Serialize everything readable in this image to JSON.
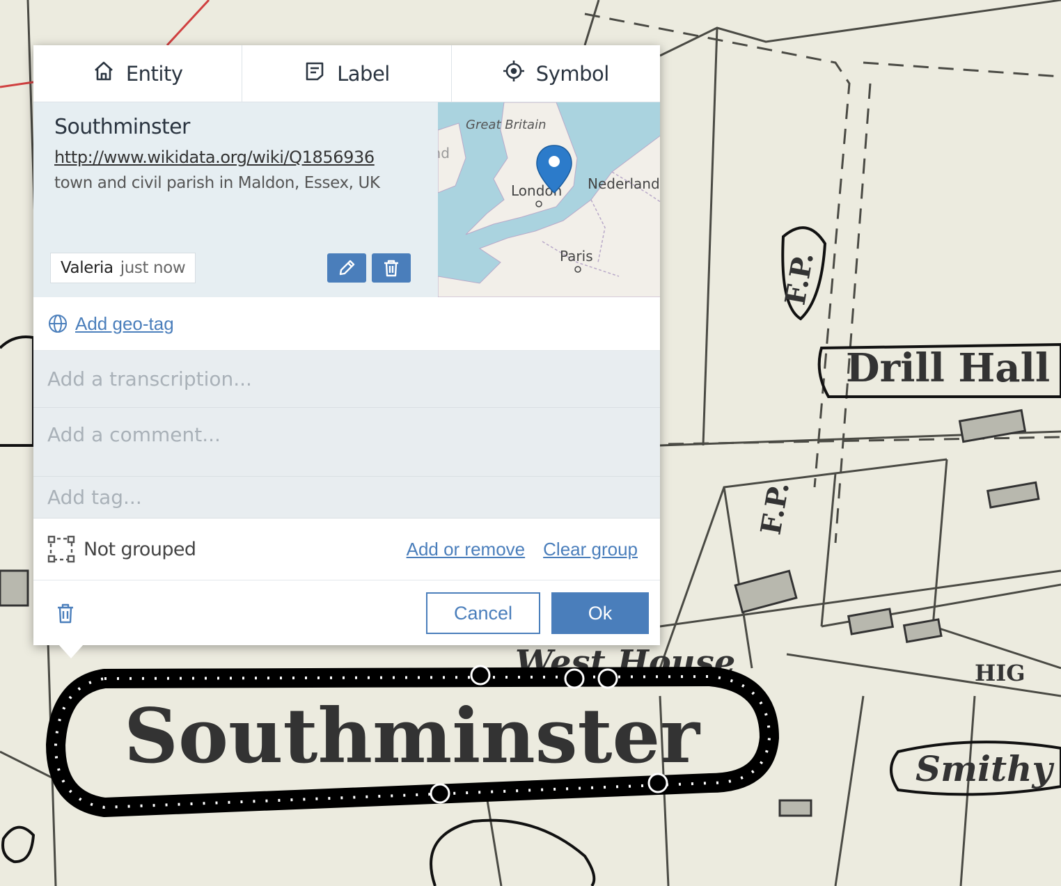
{
  "tabs": [
    {
      "label": "Entity",
      "icon": "home-icon"
    },
    {
      "label": "Label",
      "icon": "label-icon"
    },
    {
      "label": "Symbol",
      "icon": "crosshair-icon"
    }
  ],
  "entity": {
    "title": "Southminster",
    "uri": "http://www.wikidata.org/wiki/Q1856936",
    "description": "town and civil parish in Maldon, Essex, UK",
    "creator": "Valeria",
    "timestamp": "just now"
  },
  "mini_map": {
    "labels": [
      "Great Britain",
      "Éire / Ireland",
      "London",
      "Nederland",
      "Paris",
      "D"
    ]
  },
  "geotag": {
    "label": "Add geo-tag"
  },
  "inputs": {
    "transcription_placeholder": "Add a transcription...",
    "comment_placeholder": "Add a comment...",
    "tag_placeholder": "Add tag..."
  },
  "grouping": {
    "status": "Not grouped",
    "add_remove": "Add or remove",
    "clear": "Clear group"
  },
  "footer": {
    "cancel": "Cancel",
    "ok": "Ok"
  },
  "background_map": {
    "words": [
      "Southminster",
      "Drill Hall",
      "Smithy",
      "West House",
      "F.P.",
      "F.P.",
      "HIG"
    ]
  },
  "colors": {
    "accent": "#4a7ebb",
    "panel": "#e6eef2",
    "paper": "#ecebdf"
  }
}
